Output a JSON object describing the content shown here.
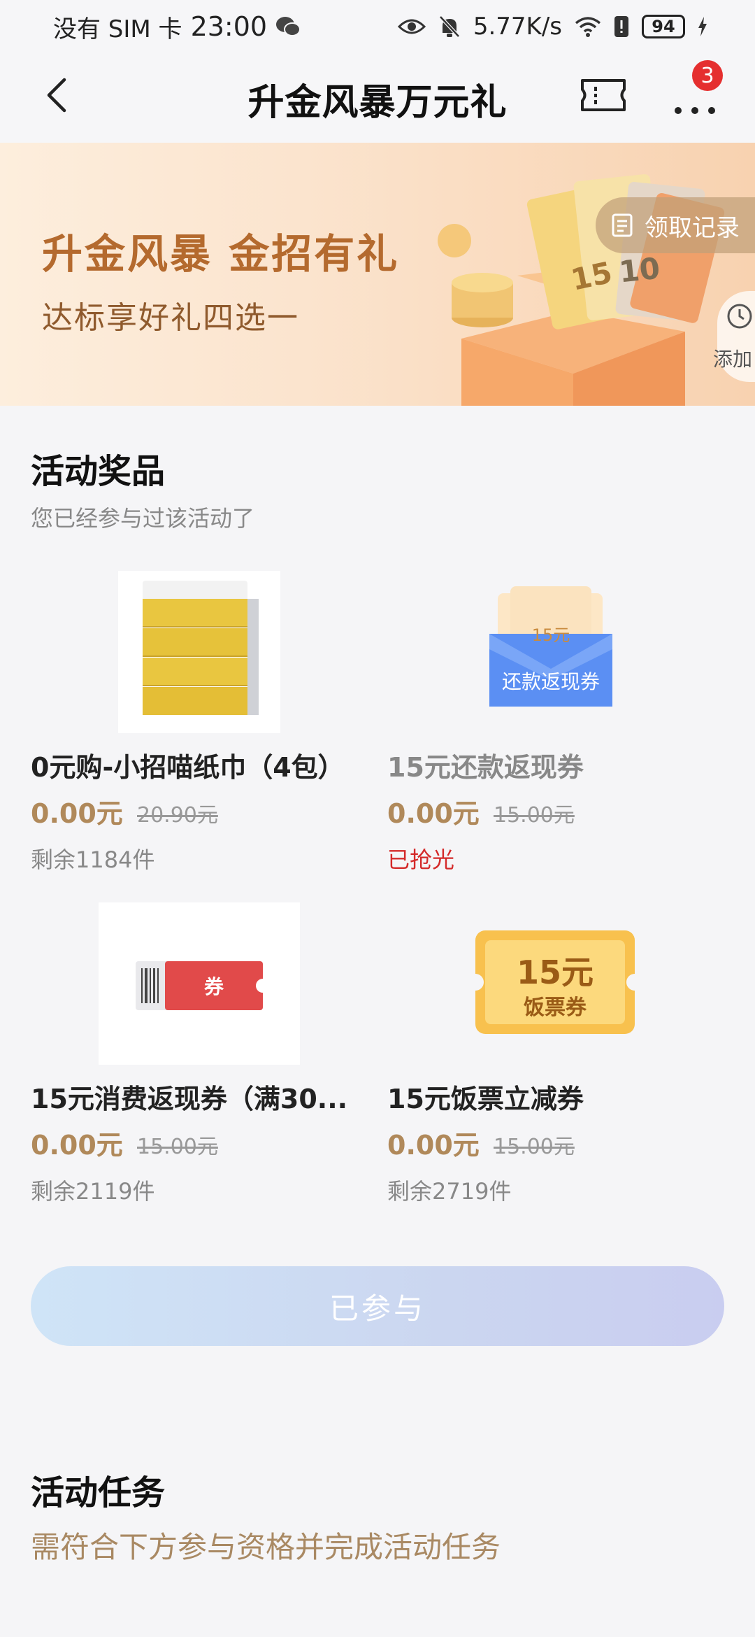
{
  "status_bar": {
    "sim": "没有 SIM 卡",
    "time": "23:00",
    "net_speed": "5.77K/s",
    "battery": "94"
  },
  "nav": {
    "title": "升金风暴万元礼",
    "badge_count": "3"
  },
  "banner": {
    "headline": "升金风暴 金招有礼",
    "subline": "达标享好礼四选一",
    "records_label": "领取记录",
    "add_label": "添加",
    "art_ticket_1": "15",
    "art_ticket_2": "10"
  },
  "prizes_section": {
    "title": "活动奖品",
    "subtitle": "您已经参与过该活动了"
  },
  "products": [
    {
      "name": "0元购-小招喵纸巾（4包）",
      "price": "0.00元",
      "original_price": "20.90元",
      "stock": "剩余1184件"
    },
    {
      "name": "15元还款返现券",
      "price": "0.00元",
      "original_price": "15.00元",
      "stock": "已抢光",
      "thumb_amount": "15元",
      "thumb_label": "还款返现券"
    },
    {
      "name": "15元消费返现券（满30...",
      "price": "0.00元",
      "original_price": "15.00元",
      "stock": "剩余2119件",
      "thumb_label": "券"
    },
    {
      "name": "15元饭票立减券",
      "price": "0.00元",
      "original_price": "15.00元",
      "stock": "剩余2719件",
      "thumb_amount": "15元",
      "thumb_label": "饭票券"
    }
  ],
  "joined_button": "已参与",
  "tasks_section": {
    "title": "活动任务",
    "subtitle": "需符合下方参与资格并完成活动任务"
  },
  "colors": {
    "price": "#b0895a",
    "sold_out": "#d42a2a",
    "banner_title": "#b46a2e"
  }
}
